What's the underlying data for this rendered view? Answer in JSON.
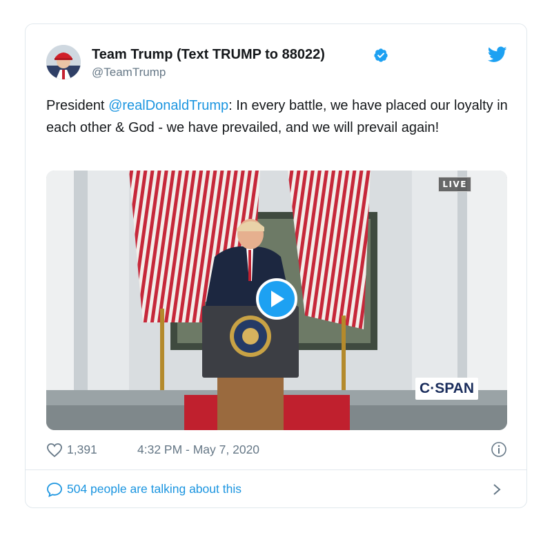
{
  "account": {
    "display_name": "Team Trump (Text TRUMP to 88022)",
    "handle": "@TeamTrump",
    "verified_icon": "verified-badge-icon"
  },
  "tweet": {
    "text_before": "President ",
    "mention": "@realDonaldTrump",
    "text_after": ": In every battle, we have placed our loyalty in each other & God - we have prevailed, and we will prevail again!"
  },
  "media": {
    "live_label": "LIVE",
    "network_label": "C·SPAN",
    "play_icon": "play-icon"
  },
  "meta": {
    "likes": "1,391",
    "timestamp": "4:32 PM - May 7, 2020"
  },
  "conversation": {
    "label": "504 people are talking about this"
  },
  "colors": {
    "link": "#1b95e0",
    "twitter_blue": "#1da1f2",
    "muted": "#657786",
    "border": "#e1e8ed"
  }
}
